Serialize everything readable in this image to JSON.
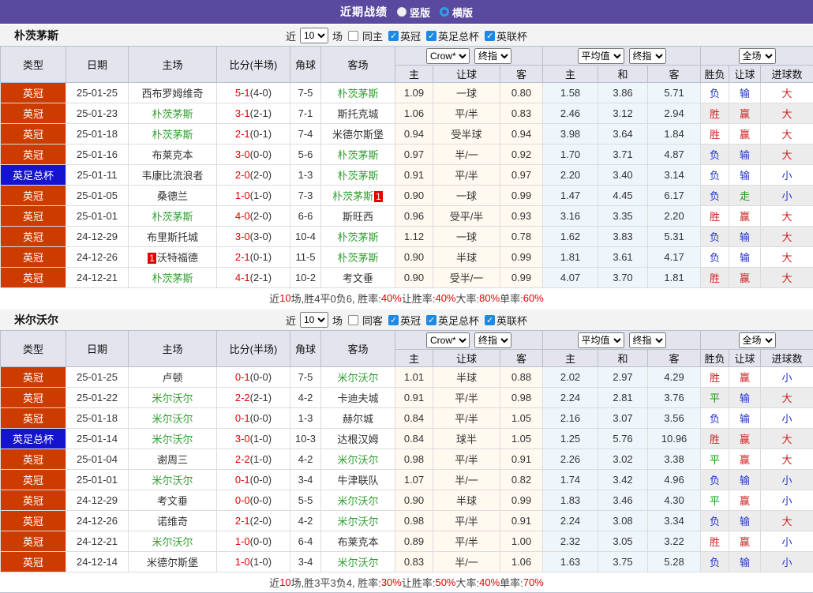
{
  "header": {
    "title": "近期战绩",
    "layout_options": [
      {
        "label": "竖版",
        "selected": true
      },
      {
        "label": "横版",
        "selected": false
      }
    ]
  },
  "columns": {
    "type": "类型",
    "date": "日期",
    "home": "主场",
    "score": "比分(半场)",
    "corner": "角球",
    "away": "客场",
    "sub": [
      "主",
      "让球",
      "客",
      "主",
      "和",
      "客",
      "胜负",
      "让球",
      "进球数"
    ]
  },
  "sections": [
    {
      "team": "朴茨茅斯",
      "filter": {
        "near_label": "近",
        "games": "10",
        "games_suffix": "场",
        "same_label": "同主",
        "same_checked": false,
        "leagues": [
          {
            "label": "英冠",
            "checked": true
          },
          {
            "label": "英足总杯",
            "checked": true
          },
          {
            "label": "英联杯",
            "checked": true
          }
        ]
      },
      "selectors": {
        "company": "Crow*",
        "company_stage": "终指",
        "average": "平均值",
        "average_stage": "终指",
        "scope": "全场"
      },
      "rows": [
        {
          "type": "英冠",
          "cup": false,
          "date": "25-01-25",
          "home": {
            "name": "西布罗姆维奇"
          },
          "ft": "5-1",
          "ht": "(4-0)",
          "corner": "7-5",
          "away": {
            "name": "朴茨茅斯",
            "green": true
          },
          "crow": [
            "1.09",
            "一球",
            "0.80"
          ],
          "avg": [
            "1.58",
            "3.86",
            "5.71"
          ],
          "res": [
            "负",
            "输",
            "大"
          ]
        },
        {
          "type": "英冠",
          "cup": false,
          "date": "25-01-23",
          "home": {
            "name": "朴茨茅斯",
            "green": true
          },
          "ft": "3-1",
          "ht": "(2-1)",
          "corner": "7-1",
          "away": {
            "name": "斯托克城"
          },
          "crow": [
            "1.06",
            "平/半",
            "0.83"
          ],
          "avg": [
            "2.46",
            "3.12",
            "2.94"
          ],
          "res": [
            "胜",
            "赢",
            "大"
          ]
        },
        {
          "type": "英冠",
          "cup": false,
          "date": "25-01-18",
          "home": {
            "name": "朴茨茅斯",
            "green": true
          },
          "ft": "2-1",
          "ht": "(0-1)",
          "corner": "7-4",
          "away": {
            "name": "米德尔斯堡"
          },
          "crow": [
            "0.94",
            "受半球",
            "0.94"
          ],
          "avg": [
            "3.98",
            "3.64",
            "1.84"
          ],
          "res": [
            "胜",
            "赢",
            "大"
          ]
        },
        {
          "type": "英冠",
          "cup": false,
          "date": "25-01-16",
          "home": {
            "name": "布莱克本"
          },
          "ft": "3-0",
          "ht": "(0-0)",
          "corner": "5-6",
          "away": {
            "name": "朴茨茅斯",
            "green": true
          },
          "crow": [
            "0.97",
            "半/一",
            "0.92"
          ],
          "avg": [
            "1.70",
            "3.71",
            "4.87"
          ],
          "res": [
            "负",
            "输",
            "大"
          ]
        },
        {
          "type": "英足总杯",
          "cup": true,
          "date": "25-01-11",
          "home": {
            "name": "韦康比流浪者"
          },
          "ft": "2-0",
          "ht": "(2-0)",
          "corner": "1-3",
          "away": {
            "name": "朴茨茅斯",
            "green": true
          },
          "crow": [
            "0.91",
            "平/半",
            "0.97"
          ],
          "avg": [
            "2.20",
            "3.40",
            "3.14"
          ],
          "res": [
            "负",
            "输",
            "小"
          ]
        },
        {
          "type": "英冠",
          "cup": false,
          "date": "25-01-05",
          "home": {
            "name": "桑德兰"
          },
          "ft": "1-0",
          "ht": "(1-0)",
          "corner": "7-3",
          "away": {
            "name": "朴茨茅斯",
            "green": true,
            "badge": "1",
            "badge_pos": "after"
          },
          "crow": [
            "0.90",
            "一球",
            "0.99"
          ],
          "avg": [
            "1.47",
            "4.45",
            "6.17"
          ],
          "res": [
            "负",
            "走",
            "小"
          ]
        },
        {
          "type": "英冠",
          "cup": false,
          "date": "25-01-01",
          "home": {
            "name": "朴茨茅斯",
            "green": true
          },
          "ft": "4-0",
          "ht": "(2-0)",
          "corner": "6-6",
          "away": {
            "name": "斯旺西"
          },
          "crow": [
            "0.96",
            "受平/半",
            "0.93"
          ],
          "avg": [
            "3.16",
            "3.35",
            "2.20"
          ],
          "res": [
            "胜",
            "赢",
            "大"
          ]
        },
        {
          "type": "英冠",
          "cup": false,
          "date": "24-12-29",
          "home": {
            "name": "布里斯托城"
          },
          "ft": "3-0",
          "ht": "(3-0)",
          "corner": "10-4",
          "away": {
            "name": "朴茨茅斯",
            "green": true
          },
          "crow": [
            "1.12",
            "一球",
            "0.78"
          ],
          "avg": [
            "1.62",
            "3.83",
            "5.31"
          ],
          "res": [
            "负",
            "输",
            "大"
          ]
        },
        {
          "type": "英冠",
          "cup": false,
          "date": "24-12-26",
          "home": {
            "name": "沃特福德",
            "badge": "1",
            "badge_pos": "before"
          },
          "ft": "2-1",
          "ht": "(0-1)",
          "corner": "11-5",
          "away": {
            "name": "朴茨茅斯",
            "green": true
          },
          "crow": [
            "0.90",
            "半球",
            "0.99"
          ],
          "avg": [
            "1.81",
            "3.61",
            "4.17"
          ],
          "res": [
            "负",
            "输",
            "大"
          ]
        },
        {
          "type": "英冠",
          "cup": false,
          "date": "24-12-21",
          "home": {
            "name": "朴茨茅斯",
            "green": true
          },
          "ft": "4-1",
          "ht": "(2-1)",
          "corner": "10-2",
          "away": {
            "name": "考文垂"
          },
          "crow": [
            "0.90",
            "受半/一",
            "0.99"
          ],
          "avg": [
            "4.07",
            "3.70",
            "1.81"
          ],
          "res": [
            "胜",
            "赢",
            "大"
          ]
        }
      ],
      "summary": [
        {
          "t": "近",
          "red": false
        },
        {
          "t": "10",
          "red": true
        },
        {
          "t": "场,胜4平0负6, 胜率:",
          "red": false
        },
        {
          "t": "40%",
          "red": true
        },
        {
          "t": " 让胜率:",
          "red": false
        },
        {
          "t": "40%",
          "red": true
        },
        {
          "t": " 大率:",
          "red": false
        },
        {
          "t": "80%",
          "red": true
        },
        {
          "t": " 单率:",
          "red": false
        },
        {
          "t": "60%",
          "red": true
        }
      ]
    },
    {
      "team": "米尔沃尔",
      "filter": {
        "near_label": "近",
        "games": "10",
        "games_suffix": "场",
        "same_label": "同客",
        "same_checked": false,
        "leagues": [
          {
            "label": "英冠",
            "checked": true
          },
          {
            "label": "英足总杯",
            "checked": true
          },
          {
            "label": "英联杯",
            "checked": true
          }
        ]
      },
      "selectors": {
        "company": "Crow*",
        "company_stage": "终指",
        "average": "平均值",
        "average_stage": "终指",
        "scope": "全场"
      },
      "rows": [
        {
          "type": "英冠",
          "cup": false,
          "date": "25-01-25",
          "home": {
            "name": "卢顿"
          },
          "ft": "0-1",
          "ht": "(0-0)",
          "corner": "7-5",
          "away": {
            "name": "米尔沃尔",
            "green": true
          },
          "crow": [
            "1.01",
            "半球",
            "0.88"
          ],
          "avg": [
            "2.02",
            "2.97",
            "4.29"
          ],
          "res": [
            "胜",
            "赢",
            "小"
          ]
        },
        {
          "type": "英冠",
          "cup": false,
          "date": "25-01-22",
          "home": {
            "name": "米尔沃尔",
            "green": true
          },
          "ft": "2-2",
          "ht": "(2-1)",
          "corner": "4-2",
          "away": {
            "name": "卡迪夫城"
          },
          "crow": [
            "0.91",
            "平/半",
            "0.98"
          ],
          "avg": [
            "2.24",
            "2.81",
            "3.76"
          ],
          "res": [
            "平",
            "输",
            "大"
          ]
        },
        {
          "type": "英冠",
          "cup": false,
          "date": "25-01-18",
          "home": {
            "name": "米尔沃尔",
            "green": true
          },
          "ft": "0-1",
          "ht": "(0-0)",
          "corner": "1-3",
          "away": {
            "name": "赫尔城"
          },
          "crow": [
            "0.84",
            "平/半",
            "1.05"
          ],
          "avg": [
            "2.16",
            "3.07",
            "3.56"
          ],
          "res": [
            "负",
            "输",
            "小"
          ]
        },
        {
          "type": "英足总杯",
          "cup": true,
          "date": "25-01-14",
          "home": {
            "name": "米尔沃尔",
            "green": true
          },
          "ft": "3-0",
          "ht": "(1-0)",
          "corner": "10-3",
          "away": {
            "name": "达根汉姆"
          },
          "crow": [
            "0.84",
            "球半",
            "1.05"
          ],
          "avg": [
            "1.25",
            "5.76",
            "10.96"
          ],
          "res": [
            "胜",
            "赢",
            "大"
          ]
        },
        {
          "type": "英冠",
          "cup": false,
          "date": "25-01-04",
          "home": {
            "name": "谢周三"
          },
          "ft": "2-2",
          "ht": "(1-0)",
          "corner": "4-2",
          "away": {
            "name": "米尔沃尔",
            "green": true
          },
          "crow": [
            "0.98",
            "平/半",
            "0.91"
          ],
          "avg": [
            "2.26",
            "3.02",
            "3.38"
          ],
          "res": [
            "平",
            "赢",
            "大"
          ]
        },
        {
          "type": "英冠",
          "cup": false,
          "date": "25-01-01",
          "home": {
            "name": "米尔沃尔",
            "green": true
          },
          "ft": "0-1",
          "ht": "(0-0)",
          "corner": "3-4",
          "away": {
            "name": "牛津联队"
          },
          "crow": [
            "1.07",
            "半/一",
            "0.82"
          ],
          "avg": [
            "1.74",
            "3.42",
            "4.96"
          ],
          "res": [
            "负",
            "输",
            "小"
          ]
        },
        {
          "type": "英冠",
          "cup": false,
          "date": "24-12-29",
          "home": {
            "name": "考文垂"
          },
          "ft": "0-0",
          "ht": "(0-0)",
          "corner": "5-5",
          "away": {
            "name": "米尔沃尔",
            "green": true
          },
          "crow": [
            "0.90",
            "半球",
            "0.99"
          ],
          "avg": [
            "1.83",
            "3.46",
            "4.30"
          ],
          "res": [
            "平",
            "赢",
            "小"
          ]
        },
        {
          "type": "英冠",
          "cup": false,
          "date": "24-12-26",
          "home": {
            "name": "诺维奇"
          },
          "ft": "2-1",
          "ht": "(2-0)",
          "corner": "4-2",
          "away": {
            "name": "米尔沃尔",
            "green": true
          },
          "crow": [
            "0.98",
            "平/半",
            "0.91"
          ],
          "avg": [
            "2.24",
            "3.08",
            "3.34"
          ],
          "res": [
            "负",
            "输",
            "大"
          ]
        },
        {
          "type": "英冠",
          "cup": false,
          "date": "24-12-21",
          "home": {
            "name": "米尔沃尔",
            "green": true
          },
          "ft": "1-0",
          "ht": "(0-0)",
          "corner": "6-4",
          "away": {
            "name": "布莱克本"
          },
          "crow": [
            "0.89",
            "平/半",
            "1.00"
          ],
          "avg": [
            "2.32",
            "3.05",
            "3.22"
          ],
          "res": [
            "胜",
            "赢",
            "小"
          ]
        },
        {
          "type": "英冠",
          "cup": false,
          "date": "24-12-14",
          "home": {
            "name": "米德尔斯堡"
          },
          "ft": "1-0",
          "ht": "(1-0)",
          "corner": "3-4",
          "away": {
            "name": "米尔沃尔",
            "green": true
          },
          "crow": [
            "0.83",
            "半/一",
            "1.06"
          ],
          "avg": [
            "1.63",
            "3.75",
            "5.28"
          ],
          "res": [
            "负",
            "输",
            "小"
          ]
        }
      ],
      "summary": [
        {
          "t": "近",
          "red": false
        },
        {
          "t": "10",
          "red": true
        },
        {
          "t": "场,胜3平3负4, 胜率:",
          "red": false
        },
        {
          "t": "30%",
          "red": true
        },
        {
          "t": " 让胜率:",
          "red": false
        },
        {
          "t": "50%",
          "red": true
        },
        {
          "t": " 大率:",
          "red": false
        },
        {
          "t": "40%",
          "red": true
        },
        {
          "t": " 单率:",
          "red": false
        },
        {
          "t": "70%",
          "red": true
        }
      ]
    }
  ]
}
